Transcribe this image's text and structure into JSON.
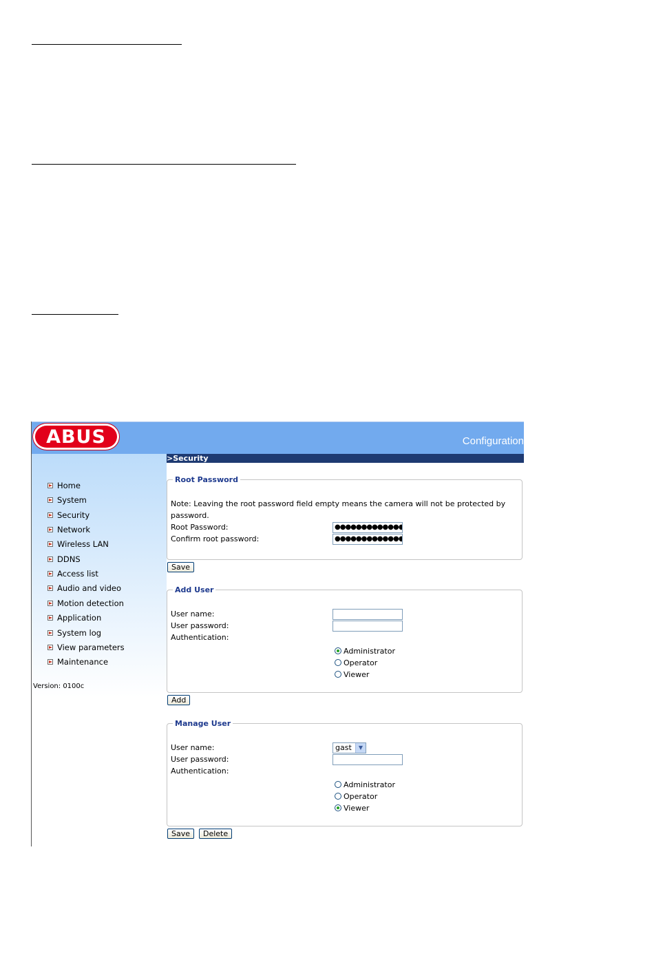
{
  "app": {
    "brand": "ABUS",
    "header_title": "Configuration",
    "section_title": ">Security",
    "version": "Version: 0100c",
    "colors": {
      "header_blue": "#72aaee",
      "section_bar": "#1e3a72",
      "brand_red": "#e2001a",
      "legend_blue": "#1e3a8e"
    }
  },
  "sidebar": {
    "items": [
      {
        "label": "Home",
        "icon": "arrow-icon"
      },
      {
        "label": "System",
        "icon": "arrow-icon"
      },
      {
        "label": "Security",
        "icon": "arrow-icon"
      },
      {
        "label": "Network",
        "icon": "arrow-icon"
      },
      {
        "label": "Wireless LAN",
        "icon": "arrow-icon"
      },
      {
        "label": "DDNS",
        "icon": "arrow-icon"
      },
      {
        "label": "Access list",
        "icon": "arrow-icon"
      },
      {
        "label": "Audio and video",
        "icon": "arrow-icon"
      },
      {
        "label": "Motion detection",
        "icon": "arrow-icon"
      },
      {
        "label": "Application",
        "icon": "arrow-icon"
      },
      {
        "label": "System log",
        "icon": "arrow-icon"
      },
      {
        "label": "View parameters",
        "icon": "arrow-icon"
      },
      {
        "label": "Maintenance",
        "icon": "arrow-icon"
      }
    ]
  },
  "root_password": {
    "legend": "Root Password",
    "note_line1": "Note: Leaving the root password field empty means the camera will not be protected by",
    "note_line2": "password.",
    "password_label": "Root Password:",
    "password_value": "●●●●●●●●●●●●●●●",
    "confirm_label": "Confirm root password:",
    "confirm_value": "●●●●●●●●●●●●●●●",
    "save_label": "Save"
  },
  "add_user": {
    "legend": "Add User",
    "username_label": "User name:",
    "username_value": "",
    "password_label": "User password:",
    "password_value": "",
    "auth_label": "Authentication:",
    "options": [
      "Administrator",
      "Operator",
      "Viewer"
    ],
    "selected": "Administrator",
    "add_label": "Add"
  },
  "manage_user": {
    "legend": "Manage User",
    "username_label": "User name:",
    "username_selected": "gast",
    "password_label": "User password:",
    "password_value": "",
    "auth_label": "Authentication:",
    "options": [
      "Administrator",
      "Operator",
      "Viewer"
    ],
    "selected": "Viewer",
    "save_label": "Save",
    "delete_label": "Delete"
  }
}
